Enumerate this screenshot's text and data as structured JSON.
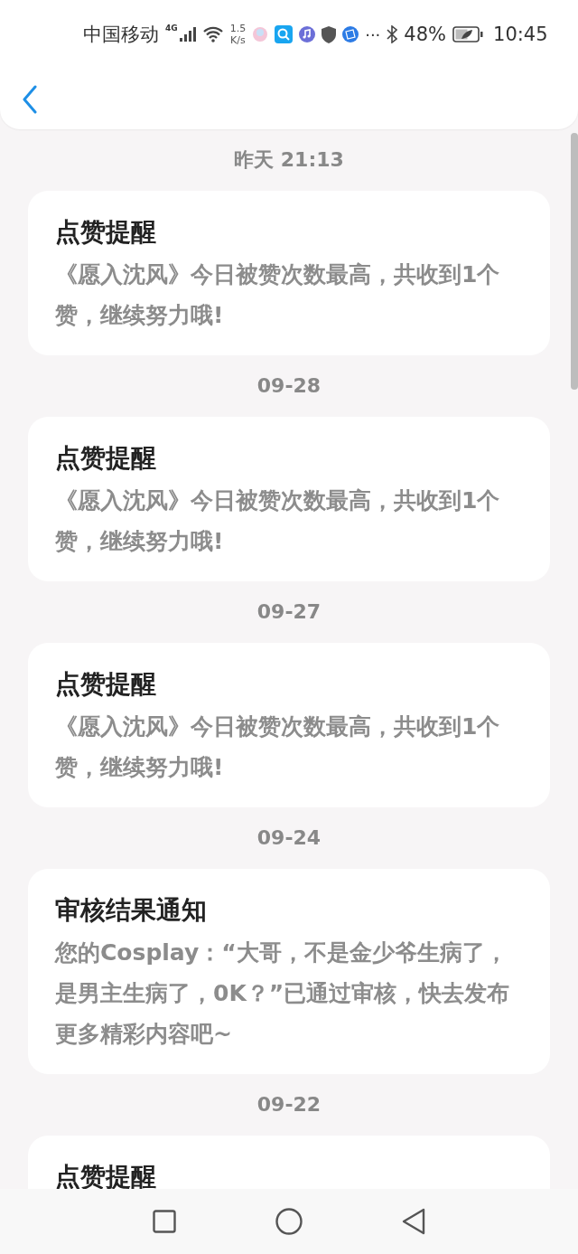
{
  "status_bar": {
    "carrier": "中国移动",
    "network_type": "4G",
    "speed_value": "1.5",
    "speed_unit": "K/s",
    "overflow": "···",
    "battery": "48%",
    "time": "10:45"
  },
  "groups": [
    {
      "date": "昨天 21:13",
      "messages": [
        {
          "title": "点赞提醒",
          "body": "《愿入沈风》今日被赞次数最高，共收到1个赞，继续努力哦!"
        }
      ]
    },
    {
      "date": "09-28",
      "messages": [
        {
          "title": "点赞提醒",
          "body": "《愿入沈风》今日被赞次数最高，共收到1个赞，继续努力哦!"
        }
      ]
    },
    {
      "date": "09-27",
      "messages": [
        {
          "title": "点赞提醒",
          "body": "《愿入沈风》今日被赞次数最高，共收到1个赞，继续努力哦!"
        }
      ]
    },
    {
      "date": "09-24",
      "messages": [
        {
          "title": "审核结果通知",
          "body": "您的Cosplay：“大哥，不是金少爷生病了，是男主生病了，0K？”已通过审核，快去发布更多精彩内容吧~"
        }
      ]
    },
    {
      "date": "09-22",
      "messages": [
        {
          "title": "点赞提醒"
        }
      ]
    }
  ]
}
